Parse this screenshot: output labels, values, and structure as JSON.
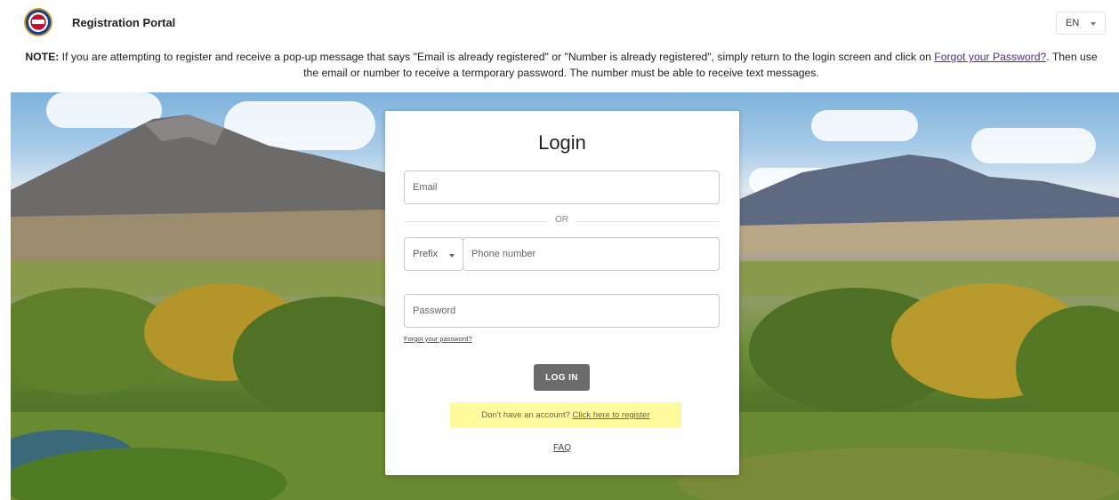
{
  "header": {
    "logo_icon": "county-seal-logo",
    "title": "Registration Portal",
    "language": "EN"
  },
  "note": {
    "prefix": "NOTE:",
    "text": " If you are attempting to register and receive a pop-up message that says \"Email is already registered\" or \"Number is already registered\", simply return to the login screen and click on ",
    "link": "Forgot your Password?",
    "suffix": ". Then use the email or number to receive a termporary password. The number must be able to receive text messages."
  },
  "login": {
    "title": "Login",
    "email_placeholder": "Email",
    "or_text": "OR",
    "prefix_placeholder": "Prefix",
    "phone_placeholder": "Phone number",
    "password_placeholder": "Password",
    "forgot_link": "Forgot your password?",
    "login_button": "LOG IN",
    "register_prompt": "Don't have an account? ",
    "register_link": "Click here to register",
    "faq_link": "FAQ"
  },
  "colors": {
    "button": "#6b6b6b",
    "highlight": "#fdfb9c",
    "link": "#5b2c8c"
  }
}
